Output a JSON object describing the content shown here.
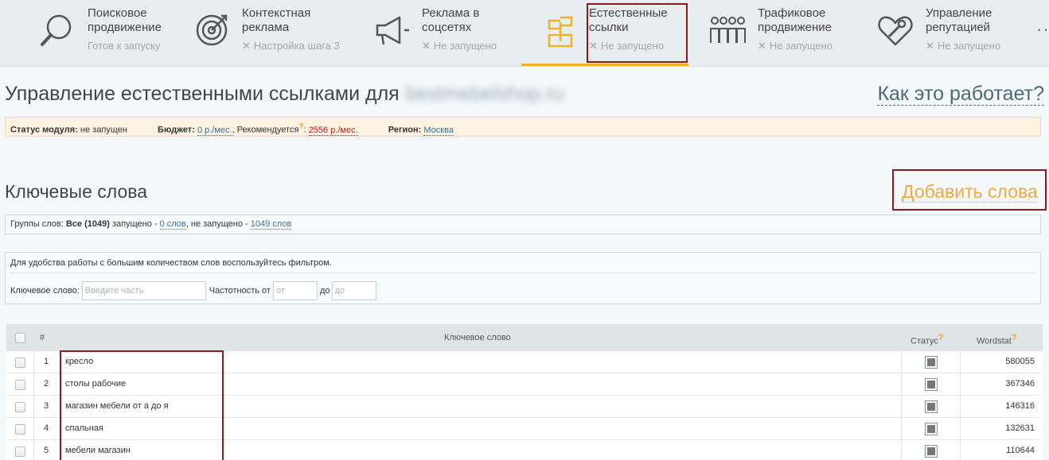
{
  "nav": [
    {
      "title": "Поисковое\nпродвижение",
      "status": "Готов к запуску",
      "icon": "search-icon",
      "has_x": false
    },
    {
      "title": "Контекстная\nреклама",
      "status": "Настройка шага 3",
      "icon": "target-icon",
      "has_x": true
    },
    {
      "title": "Реклама в\nсоцсетях",
      "status": "Не запущено",
      "icon": "megaphone-icon",
      "has_x": true
    },
    {
      "title": "Естественные\nссылки",
      "status": "Не запущено",
      "icon": "plant-icon",
      "has_x": true
    },
    {
      "title": "Трафиковое\nпродвижение",
      "status": "Не запущено",
      "icon": "people-icon",
      "has_x": true
    },
    {
      "title": "Управление\nрепутацией",
      "status": "Не запущено",
      "icon": "heart-wrench-icon",
      "has_x": true
    }
  ],
  "nav_more": "··",
  "page": {
    "title": "Управление естественными ссылками для",
    "domain": "bestmebelshop.ru",
    "how_link": "Как это работает?"
  },
  "module": {
    "status_label": "Статус модуля:",
    "status_value": "не запущен",
    "budget_label": "Бюджет:",
    "budget_value": "0 р./мес.",
    "recommended_label": "Рекомендуется",
    "recommended_q": "?",
    "recommended_value": "2556 р./мес.",
    "region_label": "Регион:",
    "region_value": "Москва"
  },
  "keywords": {
    "title": "Ключевые слова",
    "add_button": "Добавить слова"
  },
  "groups": {
    "prefix": "Группы слов:",
    "all": "Все (1049)",
    "launched_label": "запущено -",
    "launched_value": "0 слов",
    "not_launched_label": ", не запущено -",
    "not_launched_value": "1049 слов"
  },
  "filter": {
    "hint": "Для удобства работы с большим количеством слов воспользуйтесь фильтром.",
    "keyword_label": "Ключевое слово:",
    "keyword_placeholder": "Введите часть",
    "freq_label": "Частотность от",
    "from_placeholder": "от",
    "to_label": "до",
    "to_placeholder": "до"
  },
  "table": {
    "col_num": "#",
    "col_keyword": "Ключевое слово",
    "col_status": "Статус",
    "col_wordstat": "Wordstat",
    "q": "?",
    "rows": [
      {
        "n": "1",
        "keyword": "кресло",
        "wordstat": "580055"
      },
      {
        "n": "2",
        "keyword": "столы рабочие",
        "wordstat": "367346"
      },
      {
        "n": "3",
        "keyword": "магазин мебели от а до я",
        "wordstat": "146316"
      },
      {
        "n": "4",
        "keyword": "спальная",
        "wordstat": "132631"
      },
      {
        "n": "5",
        "keyword": "мебели магазин",
        "wordstat": "110644"
      }
    ]
  },
  "colors": {
    "accent": "#f0b323",
    "highlight_box": "#8b1a1a",
    "link": "#3a6d9a",
    "warn_link": "#b0241f"
  }
}
